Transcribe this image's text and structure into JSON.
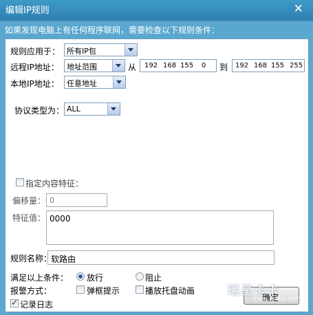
{
  "window": {
    "title": "编辑IP规则",
    "close_icon": "close-icon",
    "subtitle": "如果发现电脑上有任何程序联网，需要检查以下规则条件："
  },
  "form": {
    "apply_label": "规则应用于：",
    "apply_value": "所有IP包",
    "remote_label": "远程IP地址：",
    "remote_value": "地址范围",
    "from_label": "从",
    "from_ip": [
      "192",
      "168",
      "155",
      "0"
    ],
    "to_label": "到",
    "to_ip": [
      "192",
      "168",
      "155",
      "255"
    ],
    "local_label": "本地IP地址：",
    "local_value": "任意地址",
    "protocol_label": "协议类型为：",
    "protocol_value": "ALL",
    "content_feature_label": "指定内容特征：",
    "offset_label": "偏移量：",
    "offset_value": "0",
    "feature_label": "特征值：",
    "feature_value": "0000",
    "rule_name_label": "规则名称：",
    "rule_name_value": "软路由",
    "condition_label": "满足以上条件：",
    "allow_label": "放行",
    "block_label": "阻止",
    "alert_label": "报警方式：",
    "popup_label": "弹框提示",
    "tray_label": "播放托盘动画",
    "log_label": "记录日志",
    "ok_label": "确定"
  },
  "state": {
    "action_selected": "放行",
    "content_feature_checked": false,
    "popup_checked": false,
    "tray_checked": false,
    "log_checked": true
  },
  "watermark": {
    "text": "瑞星卡卡",
    "url": "www.ikaka.com"
  }
}
